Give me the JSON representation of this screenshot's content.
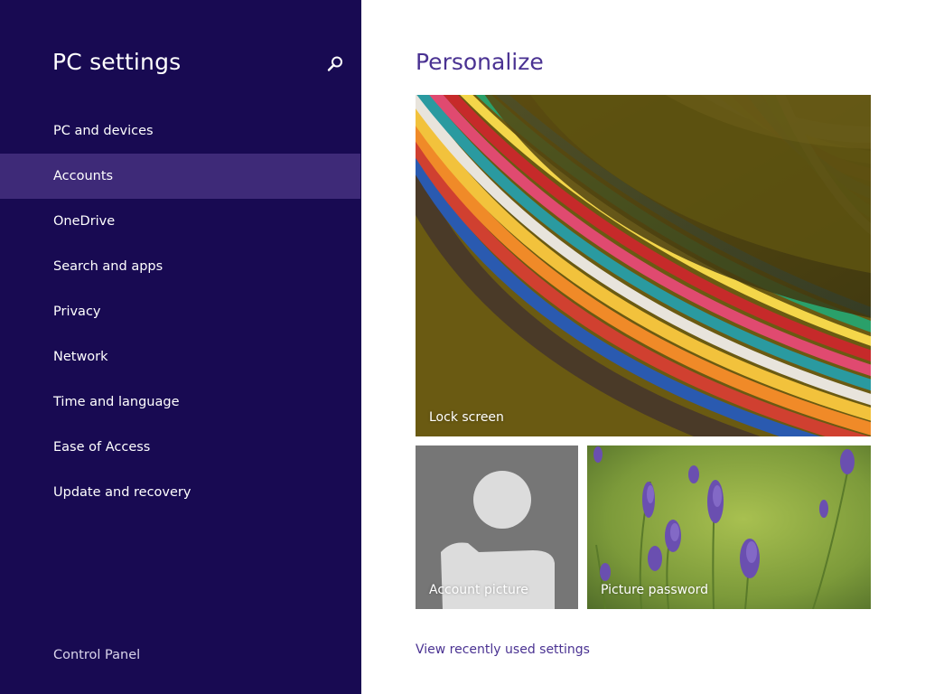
{
  "sidebar": {
    "title": "PC settings",
    "search_icon": "search-icon",
    "items": [
      {
        "label": "PC and devices",
        "selected": false
      },
      {
        "label": "Accounts",
        "selected": true
      },
      {
        "label": "OneDrive",
        "selected": false
      },
      {
        "label": "Search and apps",
        "selected": false
      },
      {
        "label": "Privacy",
        "selected": false
      },
      {
        "label": "Network",
        "selected": false
      },
      {
        "label": "Time and language",
        "selected": false
      },
      {
        "label": "Ease of Access",
        "selected": false
      },
      {
        "label": "Update and recovery",
        "selected": false
      }
    ],
    "footer_link": "Control Panel"
  },
  "main": {
    "title": "Personalize",
    "tiles": {
      "lock_screen": "Lock screen",
      "account_picture": "Account picture",
      "picture_password": "Picture password"
    },
    "recent_link": "View recently used settings"
  },
  "colors": {
    "sidebar_bg": "#180a52",
    "selected_bg": "#3e2a78",
    "accent": "#4a3292"
  }
}
